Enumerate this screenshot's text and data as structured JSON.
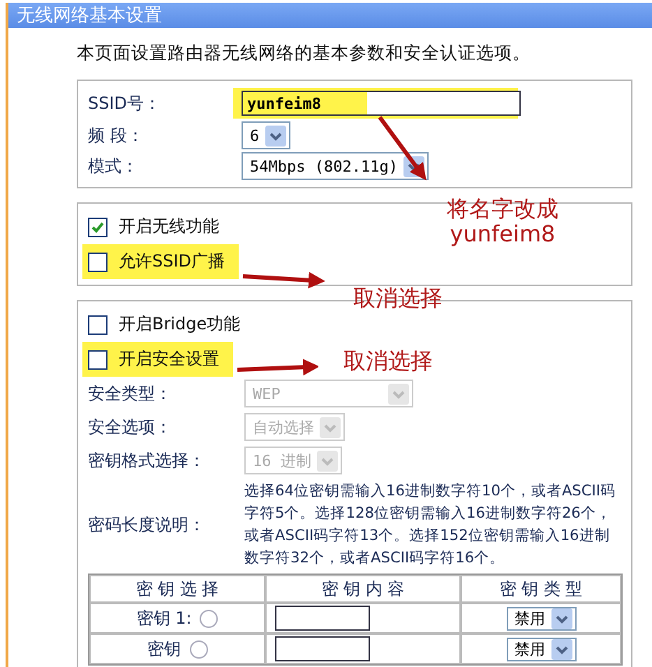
{
  "panel_title": "无线网络基本设置",
  "intro": "本页面设置路由器无线网络的基本参数和安全认证选项。",
  "basic": [
    {
      "kind": "text",
      "label": "SSID号：",
      "value": "yunfeim8",
      "highlighted": true
    },
    {
      "kind": "select",
      "label": "频 段：",
      "value": "6"
    },
    {
      "kind": "select",
      "label": "模式：",
      "value": "54Mbps (802.11g)"
    }
  ],
  "wireless_options": [
    {
      "label": "开启无线功能",
      "checked": true,
      "highlighted": false
    },
    {
      "label": "允许SSID广播",
      "checked": false,
      "highlighted": true
    }
  ],
  "security_options": [
    {
      "label": "开启Bridge功能",
      "checked": false,
      "highlighted": false
    },
    {
      "label": "开启安全设置",
      "checked": false,
      "highlighted": true
    }
  ],
  "security_fields": [
    {
      "label": "安全类型：",
      "value": "WEP",
      "disabled": true,
      "wide": true
    },
    {
      "label": "安全选项：",
      "value": "自动选择",
      "disabled": true,
      "wide": false
    },
    {
      "label": "密钥格式选择：",
      "value": "16 进制",
      "disabled": true,
      "wide": false
    }
  ],
  "length_note": {
    "label": "密码长度说明：",
    "text": "选择64位密钥需输入16进制数字符10个，或者ASCII码字符5个。选择128位密钥需输入16进制数字符26个，或者ASCII码字符13个。选择152位密钥需输入16进制数字符32个，或者ASCII码字符16个。"
  },
  "key_table": {
    "columns": [
      "密 钥 选 择",
      "密 钥 内 容",
      "密 钥 类 型"
    ],
    "rows": [
      {
        "label": "密钥 1:",
        "selected": false,
        "type": "禁用"
      },
      {
        "label": "密钥",
        "selected": false,
        "type": "禁用"
      }
    ]
  },
  "annotations": [
    {
      "text": "将名字改成\nyunfeim8"
    },
    {
      "text": "取消选择"
    },
    {
      "text": "取消选择"
    }
  ]
}
